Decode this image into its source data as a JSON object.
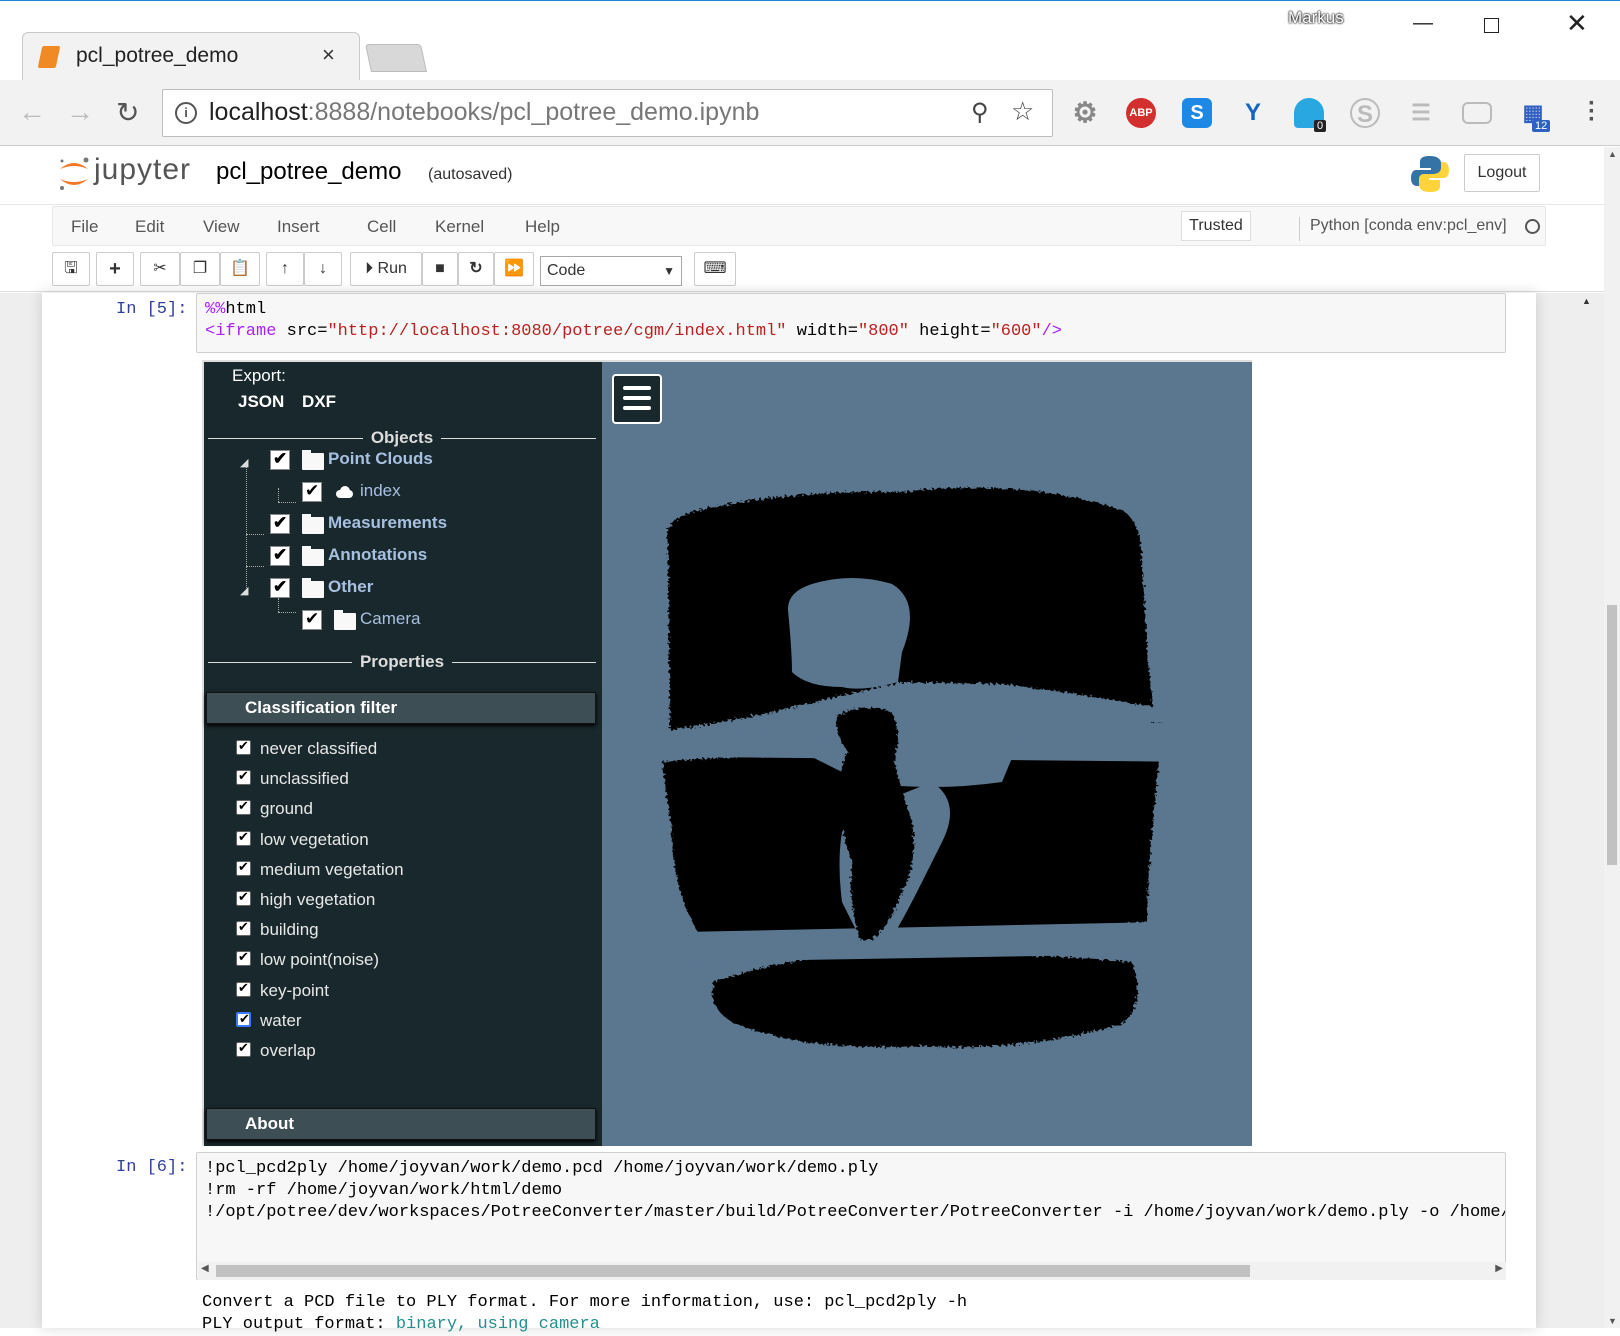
{
  "browser": {
    "user": "Markus",
    "tab_title": "pcl_potree_demo",
    "tab_close": "×",
    "url_host": "localhost",
    "url_rest": ":8888/notebooks/pcl_potree_demo.ipynb",
    "extensions": [
      {
        "name": "settings-icon",
        "color": "#888888"
      },
      {
        "name": "adblock-icon",
        "label": "ABP",
        "color": "#d32f2f"
      },
      {
        "name": "skype-s-icon",
        "label": "S",
        "color": "#1e88e5"
      },
      {
        "name": "yammer-icon",
        "label": "Y",
        "color": "#1565c0"
      },
      {
        "name": "ghostery-icon",
        "badge": "0",
        "color": "#29a7e0"
      },
      {
        "name": "skype-icon",
        "color": "#bbbbbb"
      },
      {
        "name": "reader-icon",
        "color": "#bbbbbb"
      },
      {
        "name": "cast-icon",
        "color": "#bbbbbb"
      },
      {
        "name": "tree-icon",
        "badge": "12",
        "color": "#3060c0"
      }
    ]
  },
  "jupyter": {
    "logo_text": "jupyter",
    "notebook_name": "pcl_potree_demo",
    "autosave_status": "(autosaved)",
    "logout_label": "Logout",
    "menu": [
      "File",
      "Edit",
      "View",
      "Insert",
      "Cell",
      "Kernel",
      "Help"
    ],
    "trusted_label": "Trusted",
    "kernel_name": "Python [conda env:pcl_env]",
    "run_label": "Run",
    "cell_type": "Code"
  },
  "cells": [
    {
      "prompt": "In [5]:",
      "line1_magic": "%%",
      "line1_rest": "html",
      "line2": {
        "open": "<iframe",
        "src_attr": " src=",
        "src_val": "\"http://localhost:8080/potree/cgm/index.html\"",
        "w_attr": " width=",
        "w_val": "\"800\"",
        "h_attr": " height=",
        "h_val": "\"600\"",
        "close": "/>"
      }
    },
    {
      "prompt": "In [6]:",
      "lines": [
        "!pcl_pcd2ply /home/joyvan/work/demo.pcd /home/joyvan/work/demo.ply",
        "!rm -rf /home/joyvan/work/html/demo",
        "!/opt/potree/dev/workspaces/PotreeConverter/master/build/PotreeConverter/PotreeConverter -i /home/joyvan/work/demo.ply -o /home/jo"
      ],
      "output_line1": "Convert a PCD file to PLY format. For more information, use: pcl_pcd2ply -h",
      "output_line2_prefix": "PLY output format: ",
      "output_line2_value": "binary, using camera"
    }
  ],
  "potree": {
    "export_label": "Export:",
    "export_json": "JSON",
    "export_dxf": "DXF",
    "objects_header": "Objects",
    "tree": {
      "point_clouds": "Point Clouds",
      "index": "index",
      "measurements": "Measurements",
      "annotations": "Annotations",
      "other": "Other",
      "camera": "Camera"
    },
    "properties_header": "Properties",
    "classification_filter": "Classification filter",
    "classes": [
      "never classified",
      "unclassified",
      "ground",
      "low vegetation",
      "medium vegetation",
      "high vegetation",
      "building",
      "low point(noise)",
      "key-point",
      "water",
      "overlap"
    ],
    "about": "About",
    "viewer_bg": "#5b7790"
  }
}
